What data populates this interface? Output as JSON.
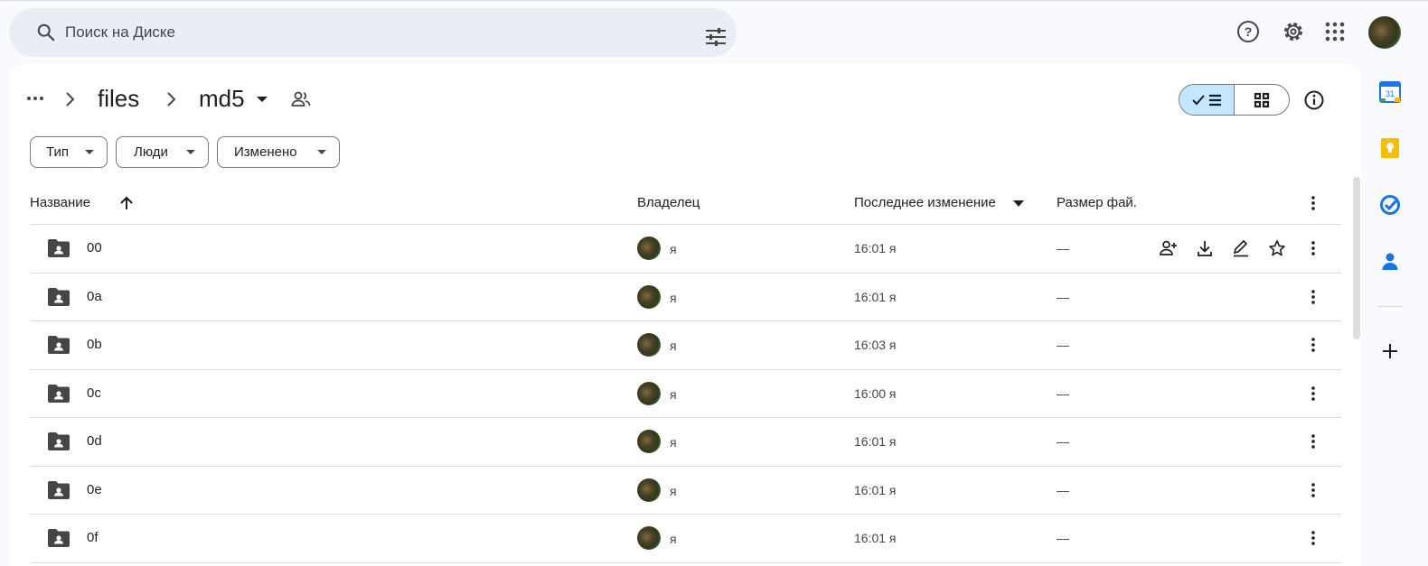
{
  "search": {
    "placeholder": "Поиск на Диске"
  },
  "breadcrumb": {
    "parent": "files",
    "current": "md5"
  },
  "filters": [
    {
      "label": "Тип"
    },
    {
      "label": "Люди"
    },
    {
      "label": "Изменено"
    }
  ],
  "table": {
    "headers": {
      "name": "Название",
      "owner": "Владелец",
      "modified": "Последнее изменение",
      "size": "Размер фай."
    },
    "rows": [
      {
        "name": "00",
        "owner": "я",
        "modified": "16:01 я",
        "size": "—"
      },
      {
        "name": "0a",
        "owner": "я",
        "modified": "16:01 я",
        "size": "—"
      },
      {
        "name": "0b",
        "owner": "я",
        "modified": "16:03 я",
        "size": "—"
      },
      {
        "name": "0c",
        "owner": "я",
        "modified": "16:00 я",
        "size": "—"
      },
      {
        "name": "0d",
        "owner": "я",
        "modified": "16:01 я",
        "size": "—"
      },
      {
        "name": "0e",
        "owner": "я",
        "modified": "16:01 я",
        "size": "—"
      },
      {
        "name": "0f",
        "owner": "я",
        "modified": "16:01 я",
        "size": "—"
      }
    ]
  },
  "rail": {
    "calendar_day": "31"
  },
  "colors": {
    "accent": "#c2e7ff",
    "search_bg": "#e9eef6",
    "keep": "#fbbc04",
    "tasks": "#1a73e8",
    "contacts": "#1a73e8"
  }
}
